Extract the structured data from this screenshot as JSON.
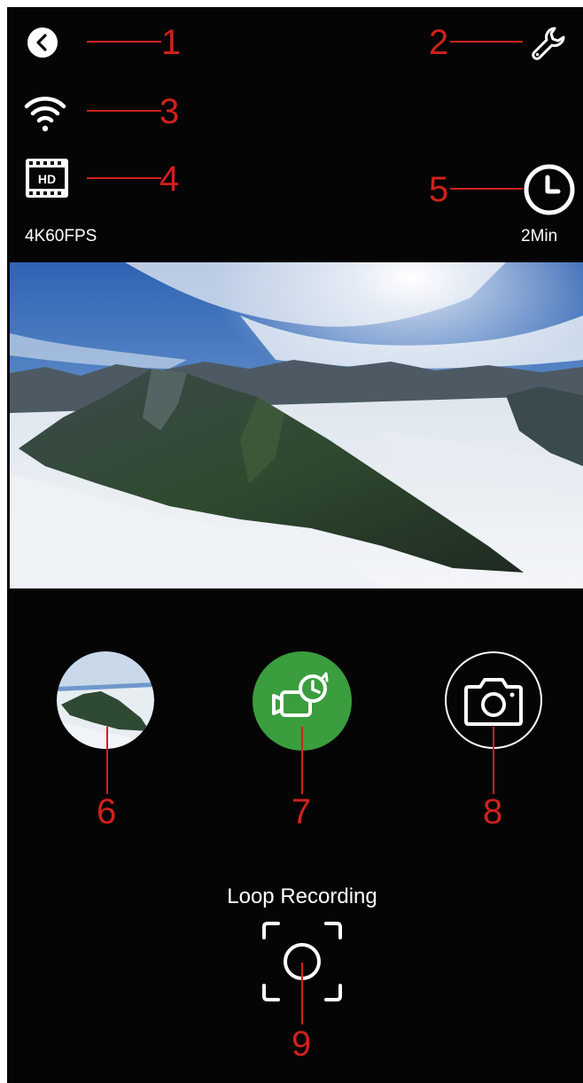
{
  "top_bar": {
    "back_icon": "chevron-left-icon",
    "settings_icon": "wrench-icon",
    "wifi_icon": "wifi-icon",
    "resolution_icon": "hd-film-icon",
    "resolution_label": "4K60FPS",
    "loop_time_icon": "clock-icon",
    "loop_time_label": "2Min"
  },
  "preview": {
    "description_icon": "live-camera-preview"
  },
  "controls": {
    "gallery_icon": "gallery-thumbnail",
    "record_mode_icon": "loop-video-icon",
    "photo_icon": "camera-icon",
    "record_mode_color": "#3a9d3e",
    "mode_label": "Loop Recording",
    "shutter_icon": "shutter-focus-icon"
  },
  "callouts": [
    "1",
    "2",
    "3",
    "4",
    "5",
    "6",
    "7",
    "8",
    "9"
  ],
  "colors": {
    "callout": "#d0211c",
    "background": "#050505",
    "accent": "#3a9d3e"
  }
}
